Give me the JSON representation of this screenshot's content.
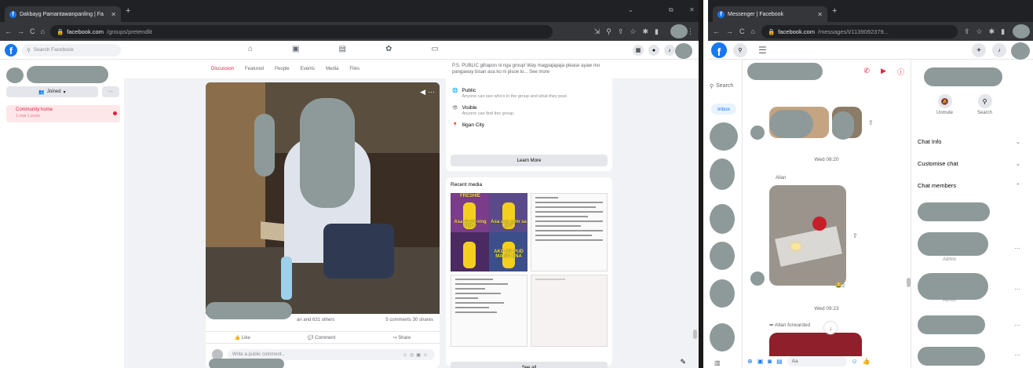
{
  "left_window": {
    "tab_title": "Dakbayg Pamantawanpanling | Fa",
    "url_host": "facebook.com",
    "url_path": "/groups/pretendlit",
    "fb_search_placeholder": "Search Facebook",
    "joined_label": "Joined",
    "more_label": "···",
    "community_home": "Community home",
    "community_home_sub": "1 new 1 posts",
    "group_tabs": [
      "Discussion",
      "Featured",
      "People",
      "Events",
      "Media",
      "Files"
    ],
    "post": {
      "reactions_text": "an and 631 others",
      "comments_shares": "5 comments  30 shares",
      "like_label": "Like",
      "comment_label": "Comment",
      "share_label": "Share",
      "comment_placeholder": "Write a public comment..."
    },
    "about": {
      "intro": "P.S. PUBLIC gihapon ni nga group! Way magpajapaja please ayaw mo pangaway bisan asa ko ni pisoe lo... See more",
      "public_title": "Public",
      "public_desc": "Anyone can see who's in the group and what they post.",
      "visible_title": "Visible",
      "visible_desc": "Anyone can find this group.",
      "location": "Iligan City",
      "learn_more": "Learn More"
    },
    "recent_media": {
      "title": "Recent media",
      "meme_labels": [
        "FRESHIE",
        "Asa dapit ning TRA?",
        "Asa ang gym sa IIT?",
        "AKO NA PUD MA SA UNA"
      ],
      "see_all": "See all"
    }
  },
  "right_window": {
    "tab_title": "Messenger | Facebook",
    "url_host": "facebook.com",
    "url_path": "/messages/t/1139092379...",
    "search_placeholder": "Search",
    "inbox_label": "Inbox",
    "timestamps": [
      "Wed 08:20",
      "Wed 09:23"
    ],
    "sender": "Allan",
    "forwarded": "Allan forwarded",
    "reaction_emoji": "😂",
    "reaction_count": "2",
    "compose_placeholder": "Aa",
    "info_buttons": [
      {
        "label": "Unmute",
        "icon": "bell-slash-icon"
      },
      {
        "label": "Search",
        "icon": "search-icon"
      }
    ],
    "info_sections": [
      "Chat Info",
      "Customise chat",
      "Chat members"
    ],
    "admin_label": "Admin"
  }
}
